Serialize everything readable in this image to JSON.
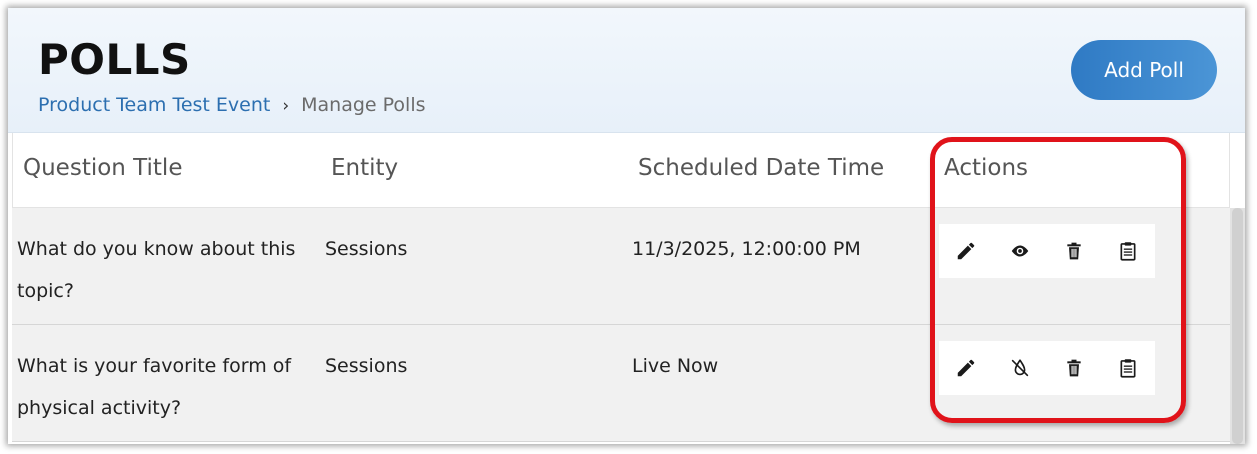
{
  "header": {
    "title": "POLLS",
    "breadcrumb": {
      "parent": "Product Team Test Event",
      "separator": "›",
      "current": "Manage Polls"
    },
    "add_button_label": "Add Poll"
  },
  "table": {
    "columns": [
      "Question Title",
      "Entity",
      "Scheduled Date Time",
      "Actions"
    ],
    "rows": [
      {
        "question": "What do you know about this topic?",
        "entity": "Sessions",
        "scheduled": "11/3/2025, 12:00:00 PM",
        "actions": [
          "pencil-icon",
          "eye-icon",
          "trash-icon",
          "clipboard-icon"
        ]
      },
      {
        "question": "What is your favorite form of physical activity?",
        "entity": "Sessions",
        "scheduled": "Live Now",
        "actions": [
          "pencil-icon",
          "eye-off-icon",
          "trash-icon",
          "clipboard-icon"
        ]
      }
    ]
  },
  "colors": {
    "accent": "#2f7ac4",
    "link": "#2c6fb0",
    "highlight": "#e0131a",
    "row_bg": "#f1f1f1"
  }
}
